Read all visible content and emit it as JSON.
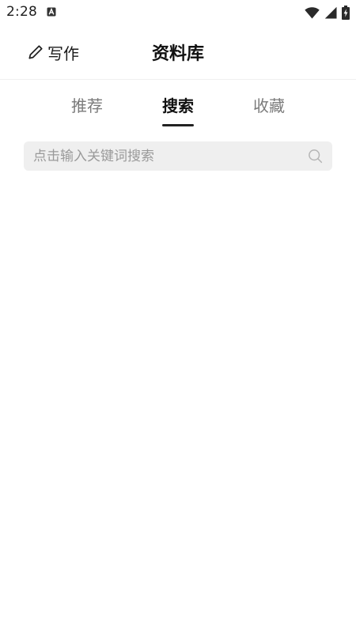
{
  "status_bar": {
    "time": "2:28",
    "notification_icon": "a-letter-icon",
    "icons": [
      "wifi-icon",
      "cell-signal-icon",
      "battery-charging-icon"
    ]
  },
  "header": {
    "write_label": "写作",
    "write_icon": "pencil-icon",
    "title": "资料库"
  },
  "tabs": [
    {
      "label": "推荐",
      "active": false
    },
    {
      "label": "搜索",
      "active": true
    },
    {
      "label": "收藏",
      "active": false
    }
  ],
  "search": {
    "placeholder": "点击输入关键词搜索",
    "value": "",
    "icon": "search-icon"
  },
  "colors": {
    "background": "#ffffff",
    "search_background": "#efefef",
    "active_tab": "#111111",
    "inactive_tab": "#7a7a7a",
    "placeholder": "#9a9a9a"
  }
}
